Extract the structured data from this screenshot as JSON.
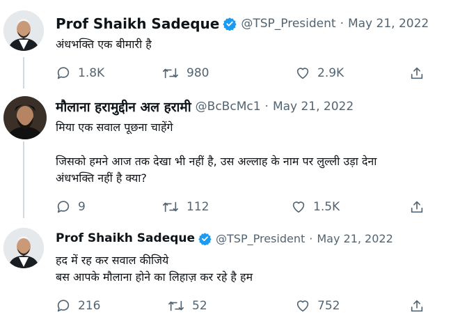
{
  "colors": {
    "text": "#0f1419",
    "secondary": "#536471",
    "verified": "#1d9bf0",
    "thread_line": "#cfd9de"
  },
  "tweets": [
    {
      "name": "Prof Shaikh Sadeque",
      "verified": true,
      "handle": "@TSP_President",
      "separator": "·",
      "date": "May 21, 2022",
      "lines": [
        "अंधभक्ति एक बीमारी है"
      ],
      "replies": "1.8K",
      "retweets": "980",
      "likes": "2.9K"
    },
    {
      "name": "मौलाना हरामुद्दीन अल हरामी",
      "verified": false,
      "handle": "@BcBcMc1",
      "separator": "·",
      "date": "May 21, 2022",
      "lines": [
        "मिया एक सवाल पूछना चाहेंगे",
        "जिसको हमने आज तक देखा भी नहीं है, उस अल्लाह के नाम पर लुल्ली उड़ा देना",
        "अंधभक्ति नहीं है क्या?"
      ],
      "replies": "9",
      "retweets": "112",
      "likes": "1.5K"
    },
    {
      "name": "Prof Shaikh Sadeque",
      "verified": true,
      "handle": "@TSP_President",
      "separator": "·",
      "date": "May 21, 2022",
      "lines": [
        "हद में रह कर सवाल कीजिये",
        "बस आपके मौलाना होने का लिहाज़ कर रहे है हम"
      ],
      "replies": "216",
      "retweets": "52",
      "likes": "752"
    }
  ]
}
